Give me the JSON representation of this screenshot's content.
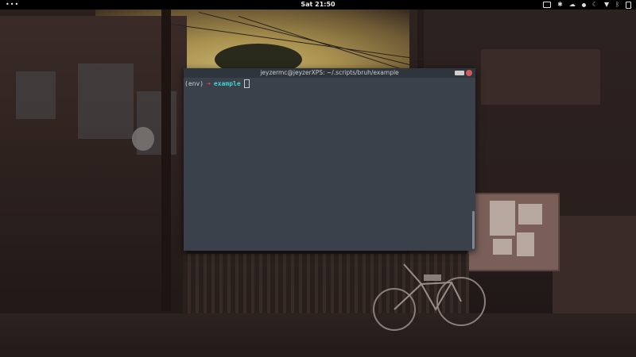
{
  "topbar": {
    "activities": "•••",
    "clock": "Sat 21:50"
  },
  "terminal": {
    "title": "jeyzermc@jeyzerXPS: ~/.scripts/bruh/example",
    "prompt_env": "(env)",
    "prompt_arrow": "➜",
    "prompt_dir": "example"
  },
  "colors": {
    "terminal_bg": "#3a414a",
    "prompt_dir": "#3fd3d3",
    "prompt_arrow": "#d14d4d"
  },
  "icons": [
    "screen-icon",
    "settings-icon",
    "cloud-icon",
    "night-mode-icon",
    "wifi-icon",
    "bluetooth-icon",
    "battery-icon"
  ]
}
